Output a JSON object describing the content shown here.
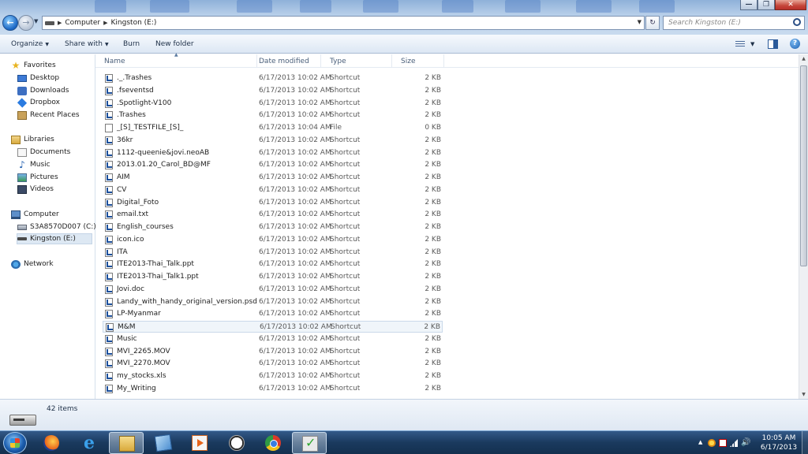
{
  "window": {
    "minimize_glyph": "—",
    "maximize_glyph": "❐",
    "close_glyph": "✕"
  },
  "address": {
    "crumbs": [
      "Computer",
      "Kingston (E:)"
    ],
    "search_placeholder": "Search Kingston (E:)"
  },
  "toolbar": {
    "organize": "Organize",
    "share_with": "Share with",
    "burn": "Burn",
    "new_folder": "New folder",
    "help": "?"
  },
  "nav": {
    "favorites": "Favorites",
    "desktop": "Desktop",
    "downloads": "Downloads",
    "dropbox": "Dropbox",
    "recent_places": "Recent Places",
    "libraries": "Libraries",
    "documents": "Documents",
    "music": "Music",
    "pictures": "Pictures",
    "videos": "Videos",
    "computer": "Computer",
    "drive_c": "S3A8570D007 (C:)",
    "drive_e": "Kingston (E:)",
    "network": "Network"
  },
  "columns": {
    "name": "Name",
    "date_modified": "Date modified",
    "type": "Type",
    "size": "Size"
  },
  "files": [
    {
      "name": "._.Trashes",
      "date": "6/17/2013 10:02 AM",
      "type": "Shortcut",
      "size": "2 KB",
      "icon": "shortcut"
    },
    {
      "name": ".fseventsd",
      "date": "6/17/2013 10:02 AM",
      "type": "Shortcut",
      "size": "2 KB",
      "icon": "shortcut"
    },
    {
      "name": ".Spotlight-V100",
      "date": "6/17/2013 10:02 AM",
      "type": "Shortcut",
      "size": "2 KB",
      "icon": "shortcut"
    },
    {
      "name": ".Trashes",
      "date": "6/17/2013 10:02 AM",
      "type": "Shortcut",
      "size": "2 KB",
      "icon": "shortcut"
    },
    {
      "name": "_[S]_TESTFILE_[S]_",
      "date": "6/17/2013 10:04 AM",
      "type": "File",
      "size": "0 KB",
      "icon": "file"
    },
    {
      "name": "36kr",
      "date": "6/17/2013 10:02 AM",
      "type": "Shortcut",
      "size": "2 KB",
      "icon": "shortcut"
    },
    {
      "name": "1112-queenie&jovi.neoAB",
      "date": "6/17/2013 10:02 AM",
      "type": "Shortcut",
      "size": "2 KB",
      "icon": "shortcut"
    },
    {
      "name": "2013.01.20_Carol_BD@MF",
      "date": "6/17/2013 10:02 AM",
      "type": "Shortcut",
      "size": "2 KB",
      "icon": "shortcut"
    },
    {
      "name": "AIM",
      "date": "6/17/2013 10:02 AM",
      "type": "Shortcut",
      "size": "2 KB",
      "icon": "shortcut"
    },
    {
      "name": "CV",
      "date": "6/17/2013 10:02 AM",
      "type": "Shortcut",
      "size": "2 KB",
      "icon": "shortcut"
    },
    {
      "name": "Digital_Foto",
      "date": "6/17/2013 10:02 AM",
      "type": "Shortcut",
      "size": "2 KB",
      "icon": "shortcut"
    },
    {
      "name": "email.txt",
      "date": "6/17/2013 10:02 AM",
      "type": "Shortcut",
      "size": "2 KB",
      "icon": "shortcut"
    },
    {
      "name": "English_courses",
      "date": "6/17/2013 10:02 AM",
      "type": "Shortcut",
      "size": "2 KB",
      "icon": "shortcut"
    },
    {
      "name": "icon.ico",
      "date": "6/17/2013 10:02 AM",
      "type": "Shortcut",
      "size": "2 KB",
      "icon": "shortcut"
    },
    {
      "name": "ITA",
      "date": "6/17/2013 10:02 AM",
      "type": "Shortcut",
      "size": "2 KB",
      "icon": "shortcut"
    },
    {
      "name": "ITE2013-Thai_Talk.ppt",
      "date": "6/17/2013 10:02 AM",
      "type": "Shortcut",
      "size": "2 KB",
      "icon": "shortcut"
    },
    {
      "name": "ITE2013-Thai_Talk1.ppt",
      "date": "6/17/2013 10:02 AM",
      "type": "Shortcut",
      "size": "2 KB",
      "icon": "shortcut"
    },
    {
      "name": "Jovi.doc",
      "date": "6/17/2013 10:02 AM",
      "type": "Shortcut",
      "size": "2 KB",
      "icon": "shortcut"
    },
    {
      "name": "Landy_with_handy_original_version.psd",
      "date": "6/17/2013 10:02 AM",
      "type": "Shortcut",
      "size": "2 KB",
      "icon": "shortcut"
    },
    {
      "name": "LP-Myanmar",
      "date": "6/17/2013 10:02 AM",
      "type": "Shortcut",
      "size": "2 KB",
      "icon": "shortcut"
    },
    {
      "name": "M&M",
      "date": "6/17/2013 10:02 AM",
      "type": "Shortcut",
      "size": "2 KB",
      "icon": "shortcut",
      "highlight": true
    },
    {
      "name": "Music",
      "date": "6/17/2013 10:02 AM",
      "type": "Shortcut",
      "size": "2 KB",
      "icon": "shortcut"
    },
    {
      "name": "MVI_2265.MOV",
      "date": "6/17/2013 10:02 AM",
      "type": "Shortcut",
      "size": "2 KB",
      "icon": "shortcut"
    },
    {
      "name": "MVI_2270.MOV",
      "date": "6/17/2013 10:02 AM",
      "type": "Shortcut",
      "size": "2 KB",
      "icon": "shortcut"
    },
    {
      "name": "my_stocks.xls",
      "date": "6/17/2013 10:02 AM",
      "type": "Shortcut",
      "size": "2 KB",
      "icon": "shortcut"
    },
    {
      "name": "My_Writing",
      "date": "6/17/2013 10:02 AM",
      "type": "Shortcut",
      "size": "2 KB",
      "icon": "shortcut"
    }
  ],
  "details": {
    "item_count": "42 items"
  },
  "taskbar": {
    "time": "10:05 AM",
    "date": "6/17/2013",
    "apps": [
      "firefox-icon",
      "internet-explorer-icon",
      "windows-explorer-icon",
      "sticky-notes-icon",
      "media-player-icon",
      "clock-icon",
      "chrome-icon",
      "checklist-icon"
    ],
    "active_app": "windows-explorer-icon"
  },
  "colors": {
    "accent": "#1a66c4",
    "selection_bg": "#dde8f3",
    "taskbar": "#1a3a5e"
  }
}
